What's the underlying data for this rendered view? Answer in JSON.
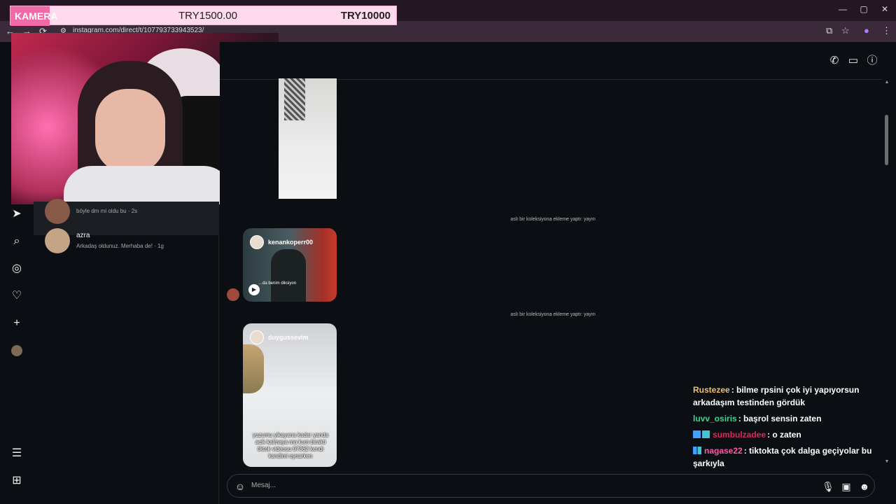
{
  "browser": {
    "url": "instagram.com/direct/t/107793733943523/",
    "controls": {
      "minimize": "—",
      "maximize": "▢",
      "close": "✕"
    },
    "nav": {
      "back": "←",
      "forward": "→",
      "reload": "⟳"
    }
  },
  "donation_bar": {
    "label": "KAMERA",
    "amount": "TRY1500.00",
    "goal": "TRY10000"
  },
  "sidebar": {
    "icons": [
      "threads-icon",
      "search-icon",
      "explore-icon",
      "heart-icon",
      "plus-icon",
      "profile-avatar",
      "menu-icon",
      "more-icon"
    ]
  },
  "dm_list": {
    "items": [
      {
        "name": "",
        "preview": "böyle dm mi oldu bu · 2s",
        "active": true
      },
      {
        "name": "azra",
        "preview": "Arkadaş oldunuz. Merhaba de! · 1g",
        "active": false
      }
    ]
  },
  "chat": {
    "system_messages": [
      "aslı bir koleksiyona ekleme yaptı: yayın",
      "aslı bir koleksiyona ekleme yaptı: yayın"
    ],
    "cards": [
      {
        "username": "kenankoperr00",
        "caption": "…da benim diksiyon"
      },
      {
        "username": "duygussevim",
        "caption": "yuzumu yikayana kadar yanda acik kalmaya ma kum birakti tiktok videosu 97362 kendi kandimi oynarken"
      }
    ],
    "composer_placeholder": "Mesaj..."
  },
  "stream_chat": [
    {
      "user": "Rustezee",
      "color": "#f0c070",
      "text": ": bilme rpsini çok iyi yapıyorsun arkadaşım testinden gördük",
      "badges": false
    },
    {
      "user": "luvv_osiris",
      "color": "#3dd68c",
      "text": ": başrol sensin zaten",
      "badges": false
    },
    {
      "user": "sumbulzadee",
      "color": "#e0285a",
      "text": ": o zaten",
      "badges": true
    },
    {
      "user": "nagase22",
      "color": "#ff5aa8",
      "text": ": tiktokta çok dalga geçiyolar bu şarkıyla",
      "badges": true
    }
  ],
  "colors": {
    "accent_pink": "#f06aa8",
    "background": "#0b0e12"
  }
}
